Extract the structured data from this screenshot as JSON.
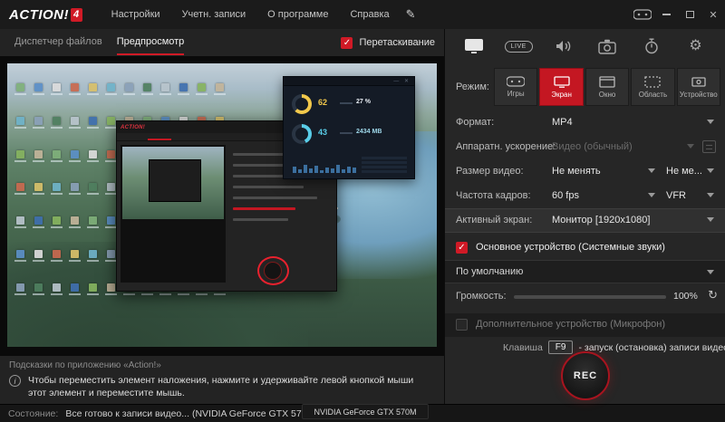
{
  "colors": {
    "accent": "#d01a26"
  },
  "titlebar": {
    "logo": "ACTION!",
    "logo_badge": "4",
    "menu": [
      {
        "label": "Настройки"
      },
      {
        "label": "Учетн. записи"
      },
      {
        "label": "О программе"
      },
      {
        "label": "Справка"
      }
    ]
  },
  "workspace": {
    "tabs": [
      {
        "label": "Диспетчер файлов"
      },
      {
        "label": "Предпросмотр"
      }
    ],
    "drag_label": "Перетаскивание",
    "gpu_badge": "NVIDIA GeForce GTX 570M",
    "hints_title": "Подсказки по приложению «Action!»",
    "hints_text": "Чтобы переместить элемент наложения, нажмите и удерживайте левой кнопкой мыши этот элемент и переместите мышь.",
    "status_label": "Состояние:",
    "status_text": "Все готово к записи видео...  (NVIDIA GeForce GTX 570M)"
  },
  "preview": {
    "inner_logo": "ACTION!",
    "hud": {
      "temp": "62",
      "load": "43",
      "cpu": "27 %",
      "ram": "2434 MB"
    },
    "icon_colors": [
      "#7fb07a",
      "#5b8fc7",
      "#dcdcdc",
      "#c9694f",
      "#d8c06a",
      "#6fb3c9",
      "#8aa0b8",
      "#4f7f5f",
      "#b8c4cc",
      "#3f6fae",
      "#86b35f",
      "#c2b49a"
    ]
  },
  "panel": {
    "live_label": "LIVE",
    "mode_label": "Режим:",
    "modes": [
      {
        "label": "Игры"
      },
      {
        "label": "Экран"
      },
      {
        "label": "Окно"
      },
      {
        "label": "Область"
      },
      {
        "label": "Устройство"
      }
    ],
    "format_label": "Формат:",
    "format_value": "MP4",
    "hw_label": "Аппаратн. ускорение:",
    "hw_value": "Видео (обычный)",
    "size_label": "Размер видео:",
    "size_value": "Не менять",
    "size_value2": "Не ме...",
    "fps_label": "Частота кадров:",
    "fps_value": "60 fps",
    "fps_value2": "VFR",
    "screen_label": "Активный экран:",
    "screen_value": "Монитор [1920x1080]",
    "audio_primary_label": "Основное устройство (Системные звуки)",
    "audio_device_value": "По умолчанию",
    "volume_label": "Громкость:",
    "volume_value": "100%",
    "audio_secondary_label": "Дополнительное устройство (Микрофон)",
    "hotkey_label": "Клавиша",
    "hotkey_key": "F9",
    "hotkey_desc": "- запуск (остановка) записи видео",
    "rec_label": "REC"
  }
}
